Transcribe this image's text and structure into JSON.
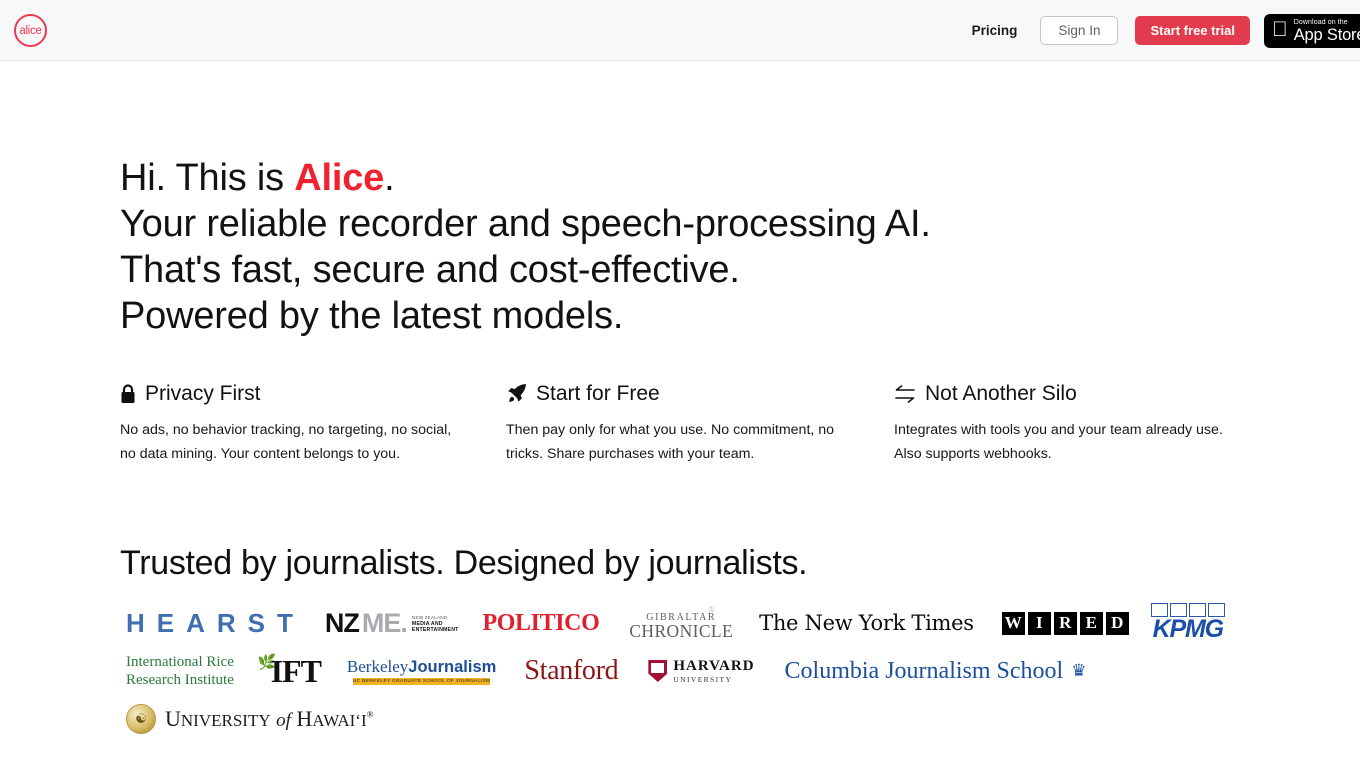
{
  "header": {
    "logo_text": "alice",
    "logo_icon": "alice-circle-logo",
    "nav": {
      "pricing": "Pricing",
      "sign_in": "Sign In",
      "start_free_trial": "Start free trial"
    },
    "appstore": {
      "small": "Download on the",
      "big": "App Store",
      "icon": "apple-logo-icon"
    },
    "colors": {
      "accent_red": "#e13b4d",
      "background": "#f7f8fa",
      "border": "#e3e6ea"
    }
  },
  "hero": {
    "line1_prefix": "Hi. This is ",
    "line1_accent": "Alice",
    "line1_suffix": ".",
    "line2": "Your reliable recorder and speech-processing AI.",
    "line3": "That's fast, secure and cost-effective.",
    "line4": "Powered by the latest models.",
    "accent_color": "#f0222f"
  },
  "features": [
    {
      "icon": "lock-icon",
      "title": "Privacy First",
      "body": "No ads, no behavior tracking, no targeting, no social, no data mining. Your content belongs to you."
    },
    {
      "icon": "rocket-icon",
      "title": "Start for Free",
      "body": "Then pay only for what you use. No commitment, no tricks. Share purchases with your team."
    },
    {
      "icon": "bidirectional-arrows-icon",
      "title": "Not Another Silo",
      "body": "Integrates with tools you and your team already use. Also supports webhooks."
    }
  ],
  "trusted": {
    "title": "Trusted by journalists. Designed by journalists.",
    "rows": [
      [
        {
          "name": "hearst-logo",
          "text": "HEARST"
        },
        {
          "name": "nzme-logo",
          "text": "NZ",
          "text2": "ME.",
          "sub1": "NEW ZEALAND",
          "sub2": "MEDIA AND",
          "sub3": "ENTERTAINMENT"
        },
        {
          "name": "politico-logo",
          "text": "POLITICO"
        },
        {
          "name": "gibraltar-chronicle-logo",
          "text": "GIBRALTAR",
          "text2": "CHRONICLE"
        },
        {
          "name": "new-york-times-logo",
          "text": "The New York Times"
        },
        {
          "name": "wired-logo",
          "text": "WIRED"
        },
        {
          "name": "kpmg-logo",
          "text": "KPMG"
        }
      ],
      [
        {
          "name": "international-rice-research-institute-logo",
          "text": "International Rice",
          "text2": "Research Institute"
        },
        {
          "name": "ift-logo",
          "text": "IFT"
        },
        {
          "name": "berkeley-journalism-logo",
          "text": "Berkeley",
          "text2": "Journalism",
          "sub1": "UC BERKELEY GRADUATE SCHOOL OF JOURNALISM"
        },
        {
          "name": "stanford-logo",
          "text": "Stanford"
        },
        {
          "name": "harvard-university-logo",
          "text": "HARVARD",
          "text2": "UNIVERSITY"
        },
        {
          "name": "columbia-journalism-school-logo",
          "text": "Columbia Journalism School"
        }
      ],
      [
        {
          "name": "university-of-hawaii-logo",
          "text": "U",
          "text2": "NIVERSITY",
          "text3": "of",
          "text4": "H",
          "text5": "AWAIʻI"
        }
      ]
    ]
  }
}
